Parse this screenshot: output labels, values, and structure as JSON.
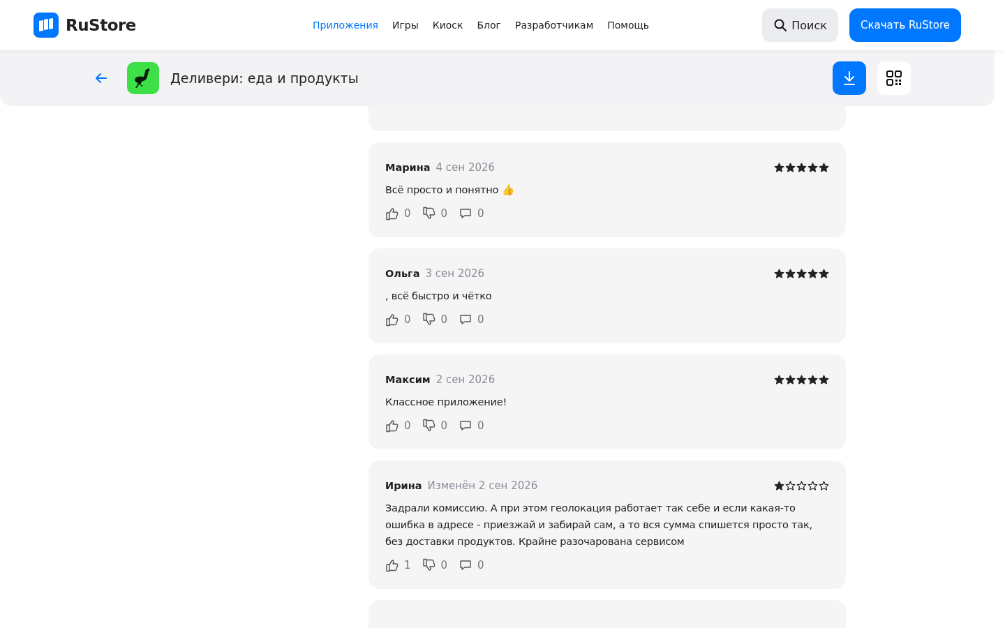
{
  "header": {
    "logo": "RuStore",
    "nav": [
      {
        "label": "Приложения",
        "selected": true
      },
      {
        "label": "Игры",
        "selected": false
      },
      {
        "label": "Киоск",
        "selected": false
      },
      {
        "label": "Блог",
        "selected": false
      },
      {
        "label": "Разработчикам",
        "selected": false
      },
      {
        "label": "Помощь",
        "selected": false
      }
    ],
    "search_button": "Поиск",
    "download_button": "Скачать RuStore"
  },
  "app_bar": {
    "title": "Деливери: еда и продукты"
  },
  "reviews": [
    {
      "author": "Марина",
      "date": "4 сен 2026",
      "stars": 5,
      "text": "Всё просто и понятно 👍",
      "likes": "0",
      "dislikes": "0",
      "comments": "0"
    },
    {
      "author": "Ольга",
      "date": "3 сен 2026",
      "stars": 5,
      "text": ", всё быстро и чётко",
      "likes": "0",
      "dislikes": "0",
      "comments": "0"
    },
    {
      "author": "Максим",
      "date": "2 сен 2026",
      "stars": 5,
      "text": "Классное приложение!",
      "likes": "0",
      "dislikes": "0",
      "comments": "0"
    },
    {
      "author": "Ирина",
      "date": "Изменён 2 сен 2026",
      "stars": 1,
      "text": "Задрали комиссию. А при этом геолокация работает так себе и если какая-то ошибка в адресе - приезжай и забирай сам, а то вся сумма спишется просто так, без доставки продуктов. Крайне разочарована сервисом",
      "likes": "1",
      "dislikes": "0",
      "comments": "0"
    }
  ]
}
